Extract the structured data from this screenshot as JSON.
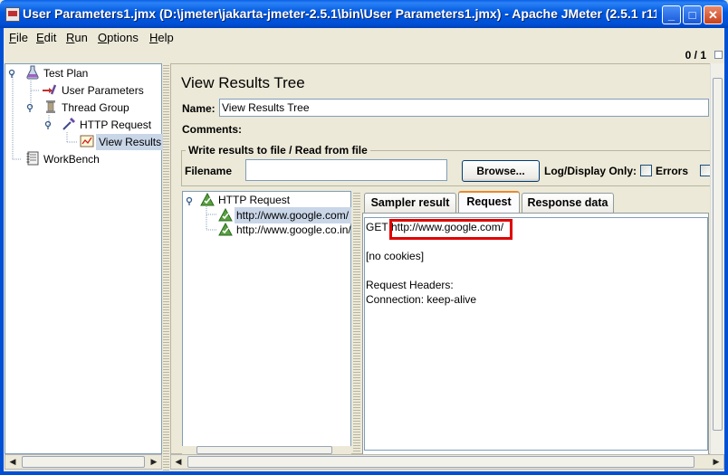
{
  "window": {
    "title": "User Parameters1.jmx (D:\\jmeter\\jakarta-jmeter-2.5.1\\bin\\User Parameters1.jmx) - Apache JMeter (2.5.1 r11...",
    "minimize": "_",
    "maximize": "□",
    "close": "✕"
  },
  "menu": {
    "file": {
      "key": "F",
      "rest": "ile"
    },
    "edit": {
      "key": "E",
      "rest": "dit"
    },
    "run": {
      "key": "R",
      "rest": "un"
    },
    "options": {
      "key": "O",
      "rest": "ptions"
    },
    "help": {
      "key": "H",
      "rest": "elp"
    }
  },
  "toolbar": {
    "counter": "0 / 1"
  },
  "tree": {
    "items": [
      {
        "label": "Test Plan",
        "icon": "flask-icon"
      },
      {
        "label": "User Parameters",
        "icon": "wrench-icon"
      },
      {
        "label": "Thread Group",
        "icon": "spool-icon"
      },
      {
        "label": "HTTP Request",
        "icon": "pipette-icon"
      },
      {
        "label": "View Results",
        "icon": "chart-icon",
        "selected": true
      },
      {
        "label": "WorkBench",
        "icon": "notebook-icon"
      }
    ]
  },
  "panel": {
    "title": "View Results Tree",
    "name_label": "Name:",
    "name_value": "View Results Tree",
    "comments_label": "Comments:",
    "group_title": "Write results to file / Read from file",
    "filename_label": "Filename",
    "filename_value": "",
    "browse_label": "Browse...",
    "log_display_label": "Log/Display Only:",
    "errors_label": "Errors"
  },
  "results": {
    "root": "HTTP Request",
    "children": [
      "http://www.google.com/",
      "http://www.google.co.in/"
    ]
  },
  "tabs": {
    "sampler": "Sampler result",
    "request": "Request",
    "response": "Response data",
    "active": "Request"
  },
  "request": {
    "method": "GET",
    "url": "http://www.google.com/",
    "cookies": "[no cookies]",
    "headers_title": "Request Headers:",
    "header_connection": "Connection: keep-alive"
  },
  "colors": {
    "highlight": "#e00000",
    "titlebar": "#0050d6",
    "tree_selected": "#c9d6e8"
  }
}
